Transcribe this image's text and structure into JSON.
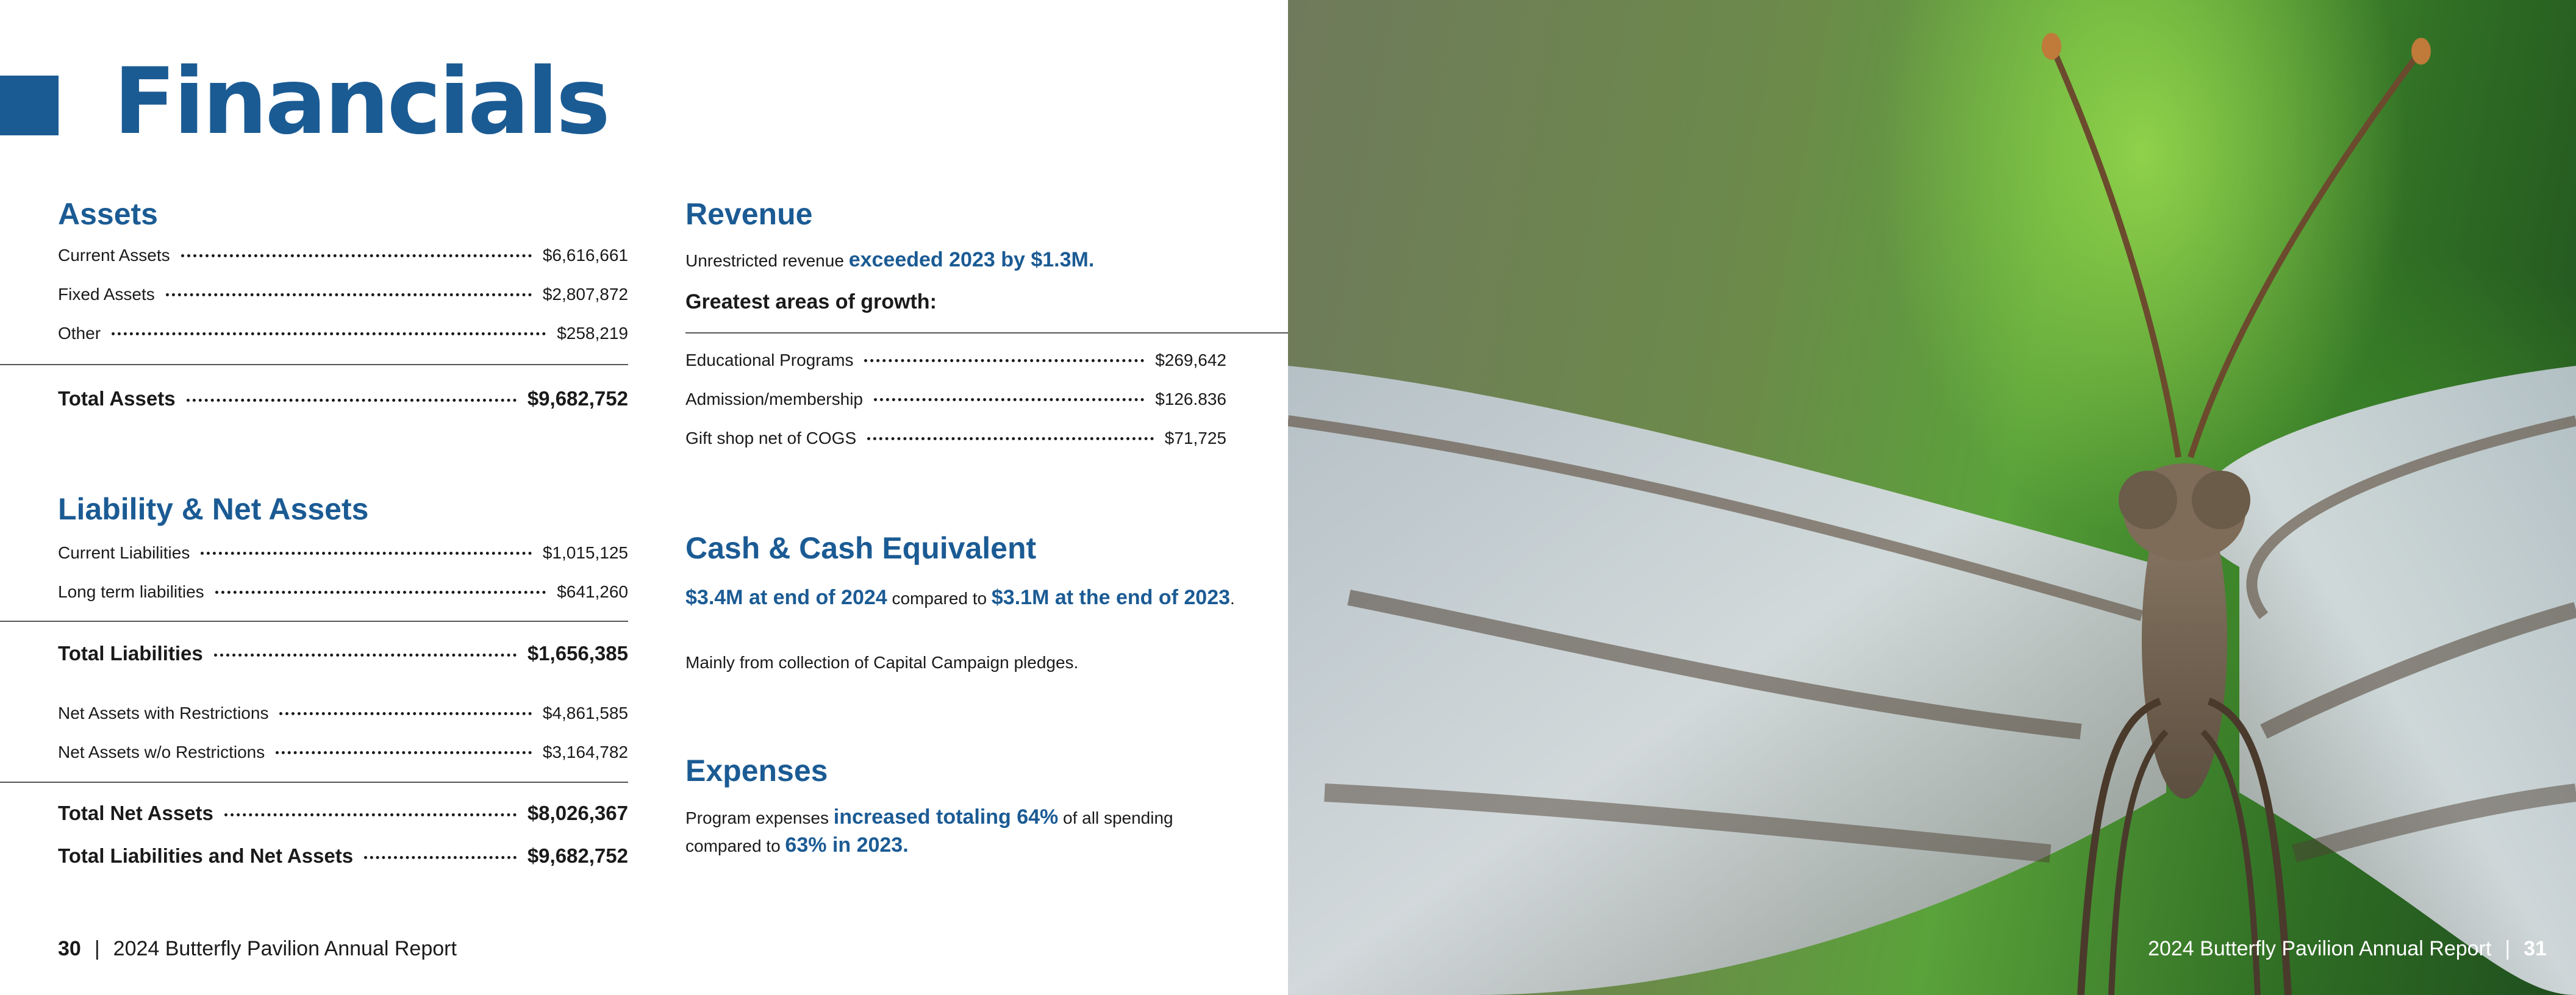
{
  "page_title": "Financials",
  "assets": {
    "heading": "Assets",
    "rows": [
      {
        "label": "Current Assets",
        "value": "$6,616,661"
      },
      {
        "label": "Fixed Assets",
        "value": "$2,807,872"
      },
      {
        "label": "Other",
        "value": "$258,219"
      }
    ],
    "total": {
      "label": "Total Assets",
      "value": "$9,682,752"
    }
  },
  "liabilities": {
    "heading": "Liability & Net Assets",
    "rows": [
      {
        "label": "Current Liabilities",
        "value": "$1,015,125"
      },
      {
        "label": "Long term liabilities",
        "value": "$641,260"
      }
    ],
    "total": {
      "label": "Total Liabilities",
      "value": "$1,656,385"
    },
    "net_rows": [
      {
        "label": "Net Assets with Restrictions",
        "value": "$4,861,585"
      },
      {
        "label": "Net Assets w/o Restrictions",
        "value": "$3,164,782"
      }
    ],
    "total_net": {
      "label": "Total Net Assets",
      "value": "$8,026,367"
    },
    "grand_total": {
      "label": "Total Liabilities and Net Assets",
      "value": "$9,682,752"
    }
  },
  "revenue": {
    "heading": "Revenue",
    "intro_plain": "Unrestricted revenue ",
    "intro_highlight": "exceeded 2023 by $1.3M.",
    "growth_heading": "Greatest areas of growth:",
    "rows": [
      {
        "label": "Educational Programs",
        "value": "$269,642"
      },
      {
        "label": "Admission/membership",
        "value": "$126.836"
      },
      {
        "label": "Gift shop net of COGS",
        "value": "$71,725"
      }
    ]
  },
  "cash": {
    "heading": "Cash & Cash Equivalent",
    "highlight_1": "$3.4M at end of 2024",
    "plain_1": " compared to ",
    "highlight_2": "$3.1M at the end of 2023",
    "plain_2": ".",
    "note": "Mainly from collection of Capital Campaign pledges."
  },
  "expenses": {
    "heading": "Expenses",
    "plain_1": "Program expenses ",
    "highlight_1": "increased totaling 64%",
    "plain_2": " of all spending compared to ",
    "highlight_2": "63% in 2023."
  },
  "footer_left": {
    "page_number": "30",
    "separator": "|",
    "text": "2024 Butterfly Pavilion Annual Report"
  },
  "footer_right": {
    "text": "2024 Butterfly Pavilion Annual Report",
    "separator": "|",
    "page_number": "31"
  },
  "colors": {
    "accent": "#1b5b94",
    "text": "#1a1a1a"
  }
}
